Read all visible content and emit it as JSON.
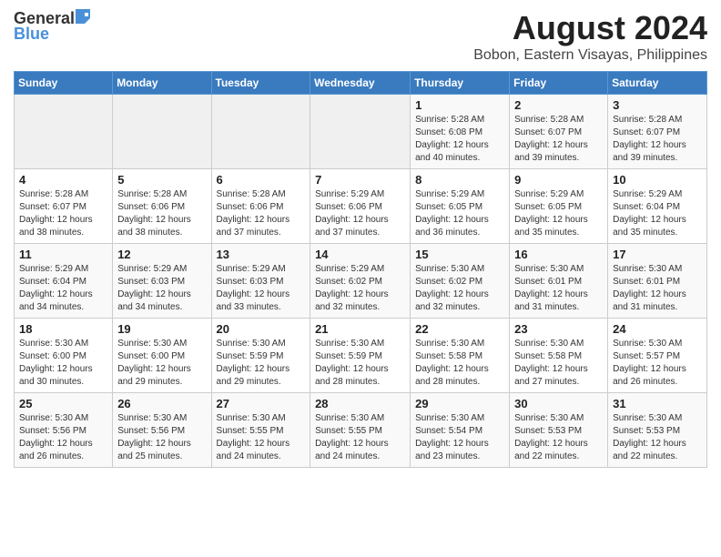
{
  "logo": {
    "general": "General",
    "blue": "Blue"
  },
  "header": {
    "title": "August 2024",
    "subtitle": "Bobon, Eastern Visayas, Philippines"
  },
  "weekdays": [
    "Sunday",
    "Monday",
    "Tuesday",
    "Wednesday",
    "Thursday",
    "Friday",
    "Saturday"
  ],
  "weeks": [
    [
      {
        "day": "",
        "sunrise": "",
        "sunset": "",
        "daylight": ""
      },
      {
        "day": "",
        "sunrise": "",
        "sunset": "",
        "daylight": ""
      },
      {
        "day": "",
        "sunrise": "",
        "sunset": "",
        "daylight": ""
      },
      {
        "day": "",
        "sunrise": "",
        "sunset": "",
        "daylight": ""
      },
      {
        "day": "1",
        "sunrise": "5:28 AM",
        "sunset": "6:08 PM",
        "daylight": "12 hours and 40 minutes."
      },
      {
        "day": "2",
        "sunrise": "5:28 AM",
        "sunset": "6:07 PM",
        "daylight": "12 hours and 39 minutes."
      },
      {
        "day": "3",
        "sunrise": "5:28 AM",
        "sunset": "6:07 PM",
        "daylight": "12 hours and 39 minutes."
      }
    ],
    [
      {
        "day": "4",
        "sunrise": "5:28 AM",
        "sunset": "6:07 PM",
        "daylight": "12 hours and 38 minutes."
      },
      {
        "day": "5",
        "sunrise": "5:28 AM",
        "sunset": "6:06 PM",
        "daylight": "12 hours and 38 minutes."
      },
      {
        "day": "6",
        "sunrise": "5:28 AM",
        "sunset": "6:06 PM",
        "daylight": "12 hours and 37 minutes."
      },
      {
        "day": "7",
        "sunrise": "5:29 AM",
        "sunset": "6:06 PM",
        "daylight": "12 hours and 37 minutes."
      },
      {
        "day": "8",
        "sunrise": "5:29 AM",
        "sunset": "6:05 PM",
        "daylight": "12 hours and 36 minutes."
      },
      {
        "day": "9",
        "sunrise": "5:29 AM",
        "sunset": "6:05 PM",
        "daylight": "12 hours and 35 minutes."
      },
      {
        "day": "10",
        "sunrise": "5:29 AM",
        "sunset": "6:04 PM",
        "daylight": "12 hours and 35 minutes."
      }
    ],
    [
      {
        "day": "11",
        "sunrise": "5:29 AM",
        "sunset": "6:04 PM",
        "daylight": "12 hours and 34 minutes."
      },
      {
        "day": "12",
        "sunrise": "5:29 AM",
        "sunset": "6:03 PM",
        "daylight": "12 hours and 34 minutes."
      },
      {
        "day": "13",
        "sunrise": "5:29 AM",
        "sunset": "6:03 PM",
        "daylight": "12 hours and 33 minutes."
      },
      {
        "day": "14",
        "sunrise": "5:29 AM",
        "sunset": "6:02 PM",
        "daylight": "12 hours and 32 minutes."
      },
      {
        "day": "15",
        "sunrise": "5:30 AM",
        "sunset": "6:02 PM",
        "daylight": "12 hours and 32 minutes."
      },
      {
        "day": "16",
        "sunrise": "5:30 AM",
        "sunset": "6:01 PM",
        "daylight": "12 hours and 31 minutes."
      },
      {
        "day": "17",
        "sunrise": "5:30 AM",
        "sunset": "6:01 PM",
        "daylight": "12 hours and 31 minutes."
      }
    ],
    [
      {
        "day": "18",
        "sunrise": "5:30 AM",
        "sunset": "6:00 PM",
        "daylight": "12 hours and 30 minutes."
      },
      {
        "day": "19",
        "sunrise": "5:30 AM",
        "sunset": "6:00 PM",
        "daylight": "12 hours and 29 minutes."
      },
      {
        "day": "20",
        "sunrise": "5:30 AM",
        "sunset": "5:59 PM",
        "daylight": "12 hours and 29 minutes."
      },
      {
        "day": "21",
        "sunrise": "5:30 AM",
        "sunset": "5:59 PM",
        "daylight": "12 hours and 28 minutes."
      },
      {
        "day": "22",
        "sunrise": "5:30 AM",
        "sunset": "5:58 PM",
        "daylight": "12 hours and 28 minutes."
      },
      {
        "day": "23",
        "sunrise": "5:30 AM",
        "sunset": "5:58 PM",
        "daylight": "12 hours and 27 minutes."
      },
      {
        "day": "24",
        "sunrise": "5:30 AM",
        "sunset": "5:57 PM",
        "daylight": "12 hours and 26 minutes."
      }
    ],
    [
      {
        "day": "25",
        "sunrise": "5:30 AM",
        "sunset": "5:56 PM",
        "daylight": "12 hours and 26 minutes."
      },
      {
        "day": "26",
        "sunrise": "5:30 AM",
        "sunset": "5:56 PM",
        "daylight": "12 hours and 25 minutes."
      },
      {
        "day": "27",
        "sunrise": "5:30 AM",
        "sunset": "5:55 PM",
        "daylight": "12 hours and 24 minutes."
      },
      {
        "day": "28",
        "sunrise": "5:30 AM",
        "sunset": "5:55 PM",
        "daylight": "12 hours and 24 minutes."
      },
      {
        "day": "29",
        "sunrise": "5:30 AM",
        "sunset": "5:54 PM",
        "daylight": "12 hours and 23 minutes."
      },
      {
        "day": "30",
        "sunrise": "5:30 AM",
        "sunset": "5:53 PM",
        "daylight": "12 hours and 22 minutes."
      },
      {
        "day": "31",
        "sunrise": "5:30 AM",
        "sunset": "5:53 PM",
        "daylight": "12 hours and 22 minutes."
      }
    ]
  ]
}
